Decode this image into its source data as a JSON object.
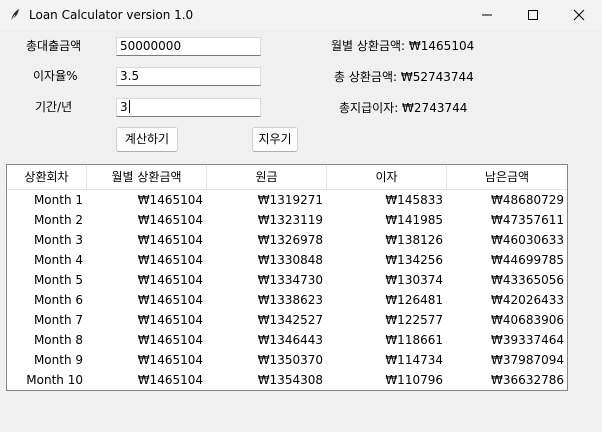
{
  "window": {
    "title": "Loan Calculator version 1.0"
  },
  "form": {
    "loan_amount_label": "총대출금액",
    "loan_amount_value": "50000000",
    "rate_label": "이자율%",
    "rate_value": "3.5",
    "term_label": "기간/년",
    "term_value": "3"
  },
  "buttons": {
    "calculate": "계산하기",
    "clear": "지우기"
  },
  "results": {
    "monthly_payment": "월별 상환금액: ₩1465104",
    "total_payment": "총 상환금액: ₩52743744",
    "total_interest": "총지급이자: ₩2743744"
  },
  "table": {
    "headers": [
      "상환회차",
      "월별 상환금액",
      "원금",
      "이자",
      "남은금액"
    ],
    "rows": [
      [
        "Month 1",
        "₩1465104",
        "₩1319271",
        "₩145833",
        "₩48680729"
      ],
      [
        "Month 2",
        "₩1465104",
        "₩1323119",
        "₩141985",
        "₩47357611"
      ],
      [
        "Month 3",
        "₩1465104",
        "₩1326978",
        "₩138126",
        "₩46030633"
      ],
      [
        "Month 4",
        "₩1465104",
        "₩1330848",
        "₩134256",
        "₩44699785"
      ],
      [
        "Month 5",
        "₩1465104",
        "₩1334730",
        "₩130374",
        "₩43365056"
      ],
      [
        "Month 6",
        "₩1465104",
        "₩1338623",
        "₩126481",
        "₩42026433"
      ],
      [
        "Month 7",
        "₩1465104",
        "₩1342527",
        "₩122577",
        "₩40683906"
      ],
      [
        "Month 8",
        "₩1465104",
        "₩1346443",
        "₩118661",
        "₩39337464"
      ],
      [
        "Month 9",
        "₩1465104",
        "₩1350370",
        "₩114734",
        "₩37987094"
      ],
      [
        "Month 10",
        "₩1465104",
        "₩1354308",
        "₩110796",
        "₩36632786"
      ]
    ]
  }
}
